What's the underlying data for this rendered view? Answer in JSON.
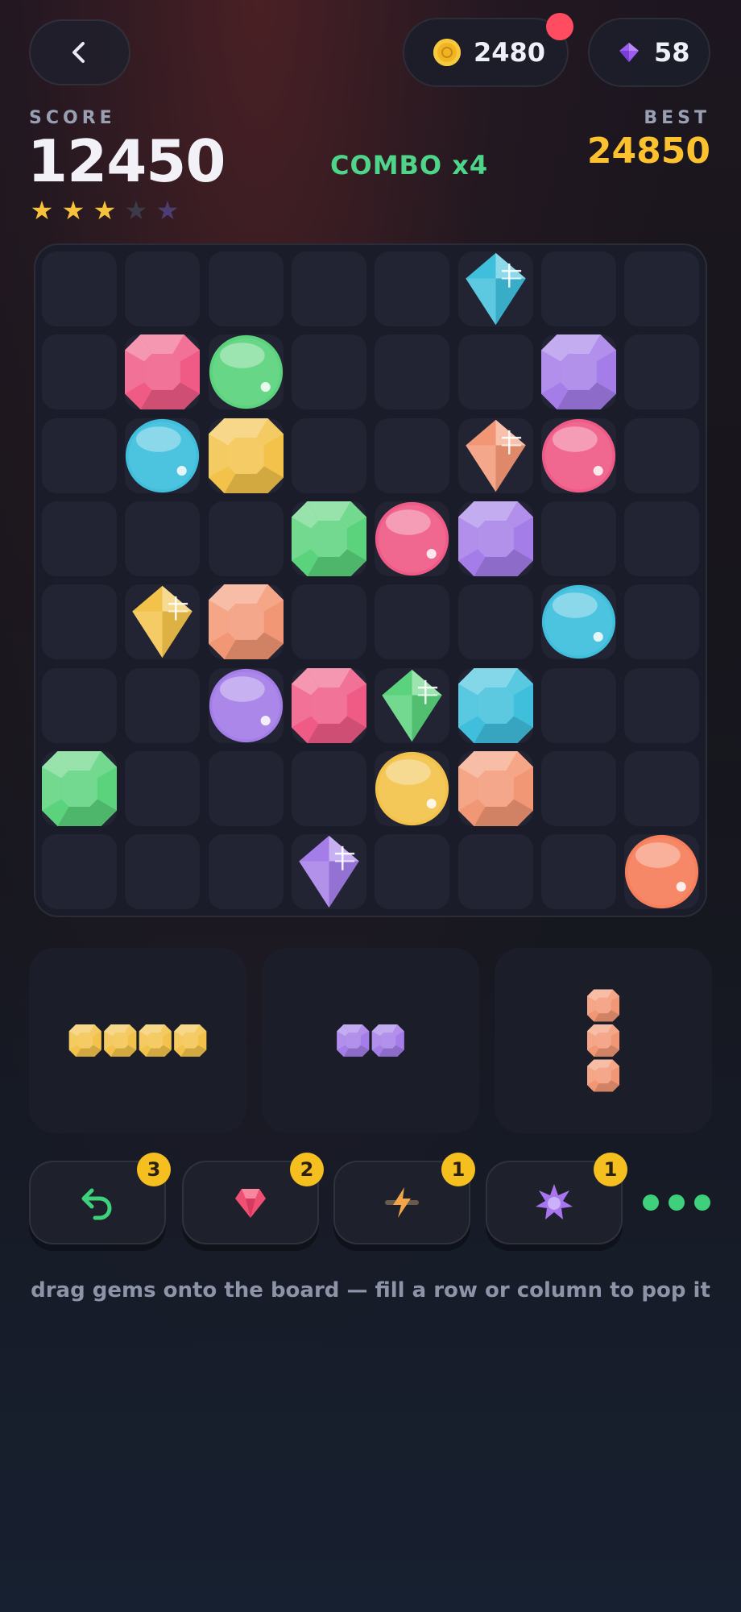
{
  "header": {
    "back_icon": "chevron-left-icon",
    "coins": "2480",
    "gems": "58",
    "coin_icon": "coin-icon",
    "gem_icon": "gem-icon",
    "notification_color": "#ff4c61"
  },
  "score": {
    "label": "SCORE",
    "value": "12450",
    "best_label": "BEST",
    "best_value": "24850",
    "combo": "COMBO x4",
    "stars_earned": 3,
    "stars_total": 5
  },
  "board": {
    "rows": 8,
    "cols": 8,
    "gems": [
      {
        "row": 0,
        "col": 5,
        "shape": "diamond",
        "color": "cyan"
      },
      {
        "row": 1,
        "col": 1,
        "shape": "octagon",
        "color": "pink"
      },
      {
        "row": 1,
        "col": 2,
        "shape": "orb",
        "color": "green"
      },
      {
        "row": 1,
        "col": 6,
        "shape": "octagon",
        "color": "purple"
      },
      {
        "row": 2,
        "col": 1,
        "shape": "orb",
        "color": "cyan"
      },
      {
        "row": 2,
        "col": 2,
        "shape": "octagon",
        "color": "yellow"
      },
      {
        "row": 2,
        "col": 5,
        "shape": "diamond",
        "color": "peach"
      },
      {
        "row": 2,
        "col": 6,
        "shape": "orb",
        "color": "pink"
      },
      {
        "row": 3,
        "col": 3,
        "shape": "octagon",
        "color": "green"
      },
      {
        "row": 3,
        "col": 4,
        "shape": "orb",
        "color": "pink"
      },
      {
        "row": 3,
        "col": 5,
        "shape": "octagon",
        "color": "purple"
      },
      {
        "row": 4,
        "col": 1,
        "shape": "diamond",
        "color": "yellow"
      },
      {
        "row": 4,
        "col": 2,
        "shape": "octagon",
        "color": "peach"
      },
      {
        "row": 4,
        "col": 6,
        "shape": "orb",
        "color": "cyan"
      },
      {
        "row": 5,
        "col": 2,
        "shape": "orb",
        "color": "purple"
      },
      {
        "row": 5,
        "col": 3,
        "shape": "octagon",
        "color": "pink"
      },
      {
        "row": 5,
        "col": 4,
        "shape": "diamond",
        "color": "green"
      },
      {
        "row": 5,
        "col": 5,
        "shape": "octagon",
        "color": "cyan"
      },
      {
        "row": 6,
        "col": 0,
        "shape": "octagon",
        "color": "green"
      },
      {
        "row": 6,
        "col": 4,
        "shape": "orb",
        "color": "yellow"
      },
      {
        "row": 6,
        "col": 5,
        "shape": "octagon",
        "color": "peach"
      },
      {
        "row": 7,
        "col": 3,
        "shape": "diamond",
        "color": "purple"
      },
      {
        "row": 7,
        "col": 7,
        "shape": "orb",
        "color": "orange"
      }
    ]
  },
  "palette": {
    "cyan": "#3fbfdc",
    "pink": "#ef5b86",
    "green": "#5bd27c",
    "purple": "#a47de8",
    "yellow": "#f2c24a",
    "peach": "#f29775",
    "orange": "#f77f5b"
  },
  "pieces": [
    {
      "name": "horizontal-four",
      "color": "yellow",
      "orientation": "horizontal",
      "count": 4
    },
    {
      "name": "horizontal-two",
      "color": "purple",
      "orientation": "horizontal",
      "count": 2
    },
    {
      "name": "vertical-three",
      "color": "peach",
      "orientation": "vertical",
      "count": 3
    }
  ],
  "powerups": [
    {
      "name": "undo",
      "icon": "undo-icon",
      "count": "3",
      "color": "#3ed07a"
    },
    {
      "name": "gem-bomb",
      "icon": "ruby-icon",
      "count": "2",
      "color": "#ef4f72"
    },
    {
      "name": "lightning",
      "icon": "lightning-icon",
      "count": "1",
      "color": "#f3a54a"
    },
    {
      "name": "burst",
      "icon": "burst-icon",
      "count": "1",
      "color": "#a775ee"
    }
  ],
  "more_icon": "more-dots-icon",
  "hint": "drag gems onto the board — fill a row or column to pop it"
}
